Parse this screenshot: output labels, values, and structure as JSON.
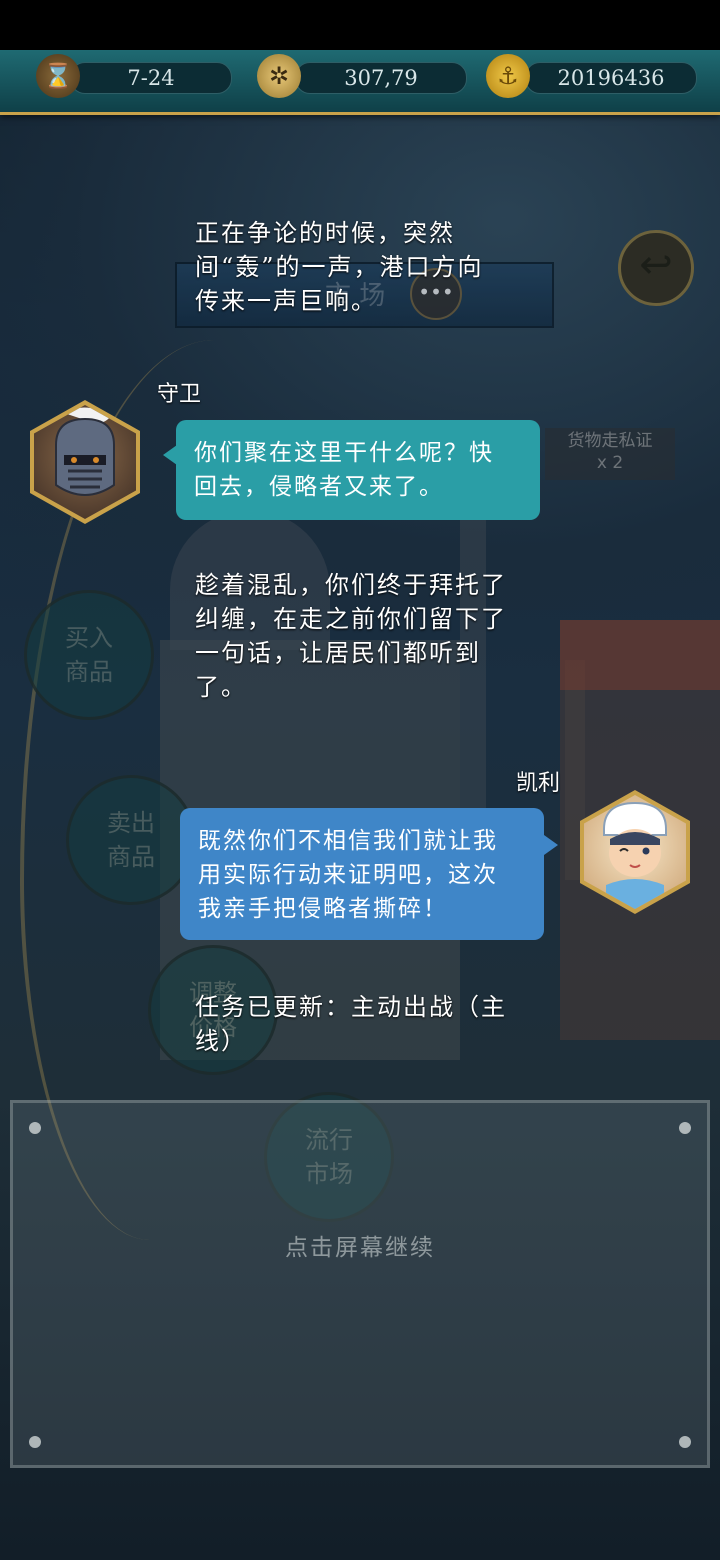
{
  "top_bar": {
    "date": "7-24",
    "compass_value": "307,79",
    "gold": "20196436",
    "icons": [
      "hourglass-icon",
      "compass-icon",
      "gold-coin-icon"
    ]
  },
  "background_menu": {
    "banner_label": "市 场",
    "buttons": [
      {
        "label": "买入商品",
        "line1": "买入",
        "line2": "商品"
      },
      {
        "label": "卖出商品",
        "line1": "卖出",
        "line2": "商品"
      },
      {
        "label": "调整价格",
        "line1": "调整",
        "line2": "价格"
      },
      {
        "label": "流行市场",
        "line1": "流行",
        "line2": "市场"
      }
    ],
    "cargo_label": "货物走私证",
    "cargo_count": "x 2"
  },
  "dialogue": {
    "narration_1": [
      "正在争论的时候，突然",
      "间“轰”的一声，港口方向",
      "传来一声巨响。"
    ],
    "guard": {
      "name": "守卫",
      "lines": [
        "你们聚在这里干什么呢？快",
        "回去，侵略者又来了。"
      ]
    },
    "narration_2": [
      "趁着混乱，你们终于拜托了",
      "纠缠，在走之前你们留下了",
      "一句话，让居民们都听到",
      "了。"
    ],
    "kelly": {
      "name": "凯利",
      "lines": [
        "既然你们不相信我们就让我",
        "用实际行动来证明吧，这次",
        "我亲手把侵略者撕碎！"
      ]
    },
    "quest_update": [
      "任务已更新：主动出战（主",
      "线）"
    ]
  },
  "prompt": {
    "continue": "点击屏幕继续"
  },
  "colors": {
    "top_bar": "#1f6a72",
    "gold_trim": "#c9a24a",
    "guard_bubble": "#2a9ea6",
    "kelly_bubble": "#3f86c8"
  }
}
